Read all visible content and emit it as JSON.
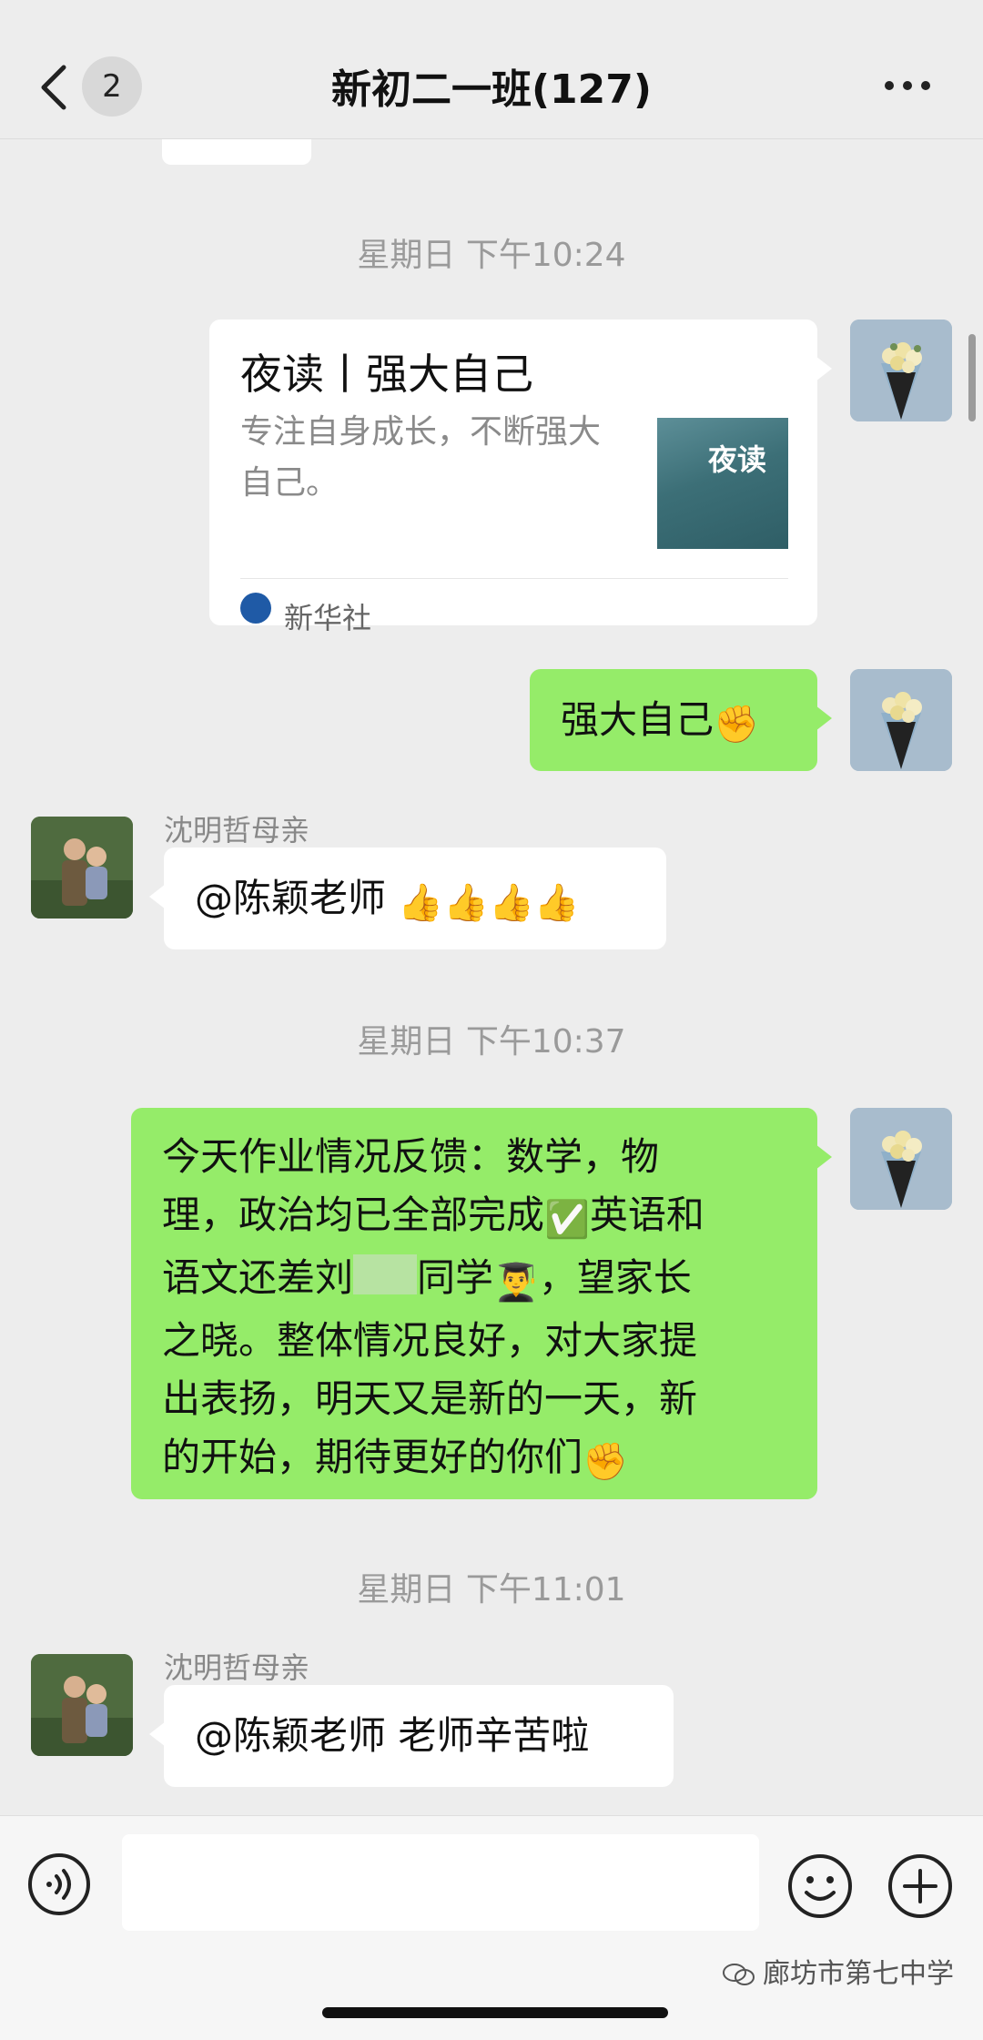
{
  "nav": {
    "unread_count": "2",
    "title": "新初二一班(127)"
  },
  "timestamps": [
    "星期日 下午10:24",
    "星期日 下午10:37",
    "星期日 下午11:01"
  ],
  "messages": {
    "link_card": {
      "title": "夜读丨强大自己",
      "description": "专注自身成长，不断强大自己。",
      "thumb_text": "夜读",
      "source": "新华社"
    },
    "self_short": {
      "text": "强大自己",
      "emoji": "✊"
    },
    "parent_1": {
      "sender": "沈明哲母亲",
      "text": "@陈颖老师 ",
      "emoji": "👍👍👍👍"
    },
    "self_long": {
      "line1": "今天作业情况反馈：数学，物",
      "line2a": "理，政治均已全部完成",
      "line2_emoji": "✅",
      "line2b": "英语和",
      "line3a": "语文还差刘",
      "line3_blur": "   ",
      "line3b": "同学",
      "line3_emoji": "👨‍🎓",
      "line3c": "，望家长",
      "line4": "之晓。整体情况良好，对大家提",
      "line5": "出表扬，明天又是新的一天，新",
      "line6a": "的开始，期待更好的你们",
      "line6_emoji": "✊"
    },
    "parent_2": {
      "sender": "沈明哲母亲",
      "text": "@陈颖老师 老师辛苦啦"
    }
  },
  "input": {
    "value": "",
    "placeholder": ""
  },
  "watermark": "廊坊市第七中学",
  "icons": {
    "back": "chevron-left-icon",
    "more": "more-dots-icon",
    "voice": "voice-icon",
    "emoji": "emoji-face-icon",
    "plus": "plus-icon"
  },
  "colors": {
    "background": "#ededed",
    "self_bubble": "#95ec69",
    "other_bubble": "#ffffff",
    "timestamp": "#9a9a9a"
  }
}
